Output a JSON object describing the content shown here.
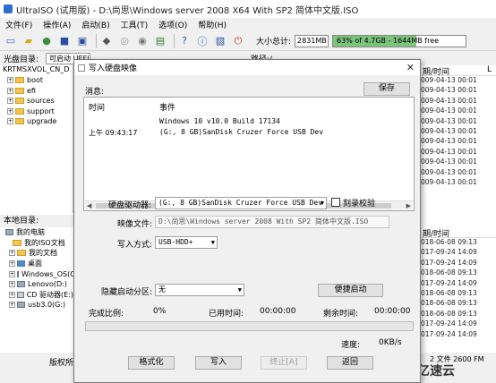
{
  "window": {
    "title": "UltraISO (试用版) - D:\\尚思\\Windows server 2008 X64 With SP2 简体中文版.ISO"
  },
  "menu": [
    "文件(F)",
    "操作(A)",
    "启动(B)",
    "工具(T)",
    "选项(O)",
    "帮助(H)"
  ],
  "toolbar": {
    "size_label": "大小总计:",
    "size_value": "2831MB",
    "capacity_text": "63% of 4.7GB - 1644MB free",
    "capacity_fraction": 0.63
  },
  "disc_bar": {
    "label": "光盘目录:",
    "type_value": "可启动 UEFI",
    "path_label": "路径:/"
  },
  "tree": {
    "root": "KRTMSXVOL_CN_D",
    "folders": [
      "boot",
      "efi",
      "sources",
      "support",
      "upgrade"
    ]
  },
  "right_list": {
    "header": "期/时间",
    "header2": "L",
    "rows": [
      "009-04-13 00:01",
      "009-04-13 00:01",
      "009-04-13 00:01",
      "009-04-13 00:01",
      "009-04-13 00:01",
      "009-04-13 00:01",
      "009-04-13 00:01",
      "009-04-13 00:01",
      "009-04-13 00:01",
      "009-04-13 00:01",
      "009-04-13 00:01"
    ]
  },
  "local": {
    "label": "本地目录:",
    "items": [
      "我的电脑",
      "我的ISO文档",
      "我的文档",
      "桌面",
      "Windows_OS(C:)",
      "Lenovo(D:)",
      "CD 驱动器(E:)",
      "usb3.0(G:)"
    ]
  },
  "right_list2": {
    "header": "期/时间",
    "header2": "",
    "rows": [
      "018-06-08 09:13",
      "017-09-24 14:09",
      "017-09-24 14:09",
      "018-06-08 09:13",
      "017-09-24 14:09",
      "018-06-08 09:13",
      "018-06-08 09:13",
      "018-06-08 09:13",
      "017-09-24 14:09",
      "017-09-24 14:09"
    ]
  },
  "bottom": {
    "left_text": "版权所",
    "right_text": "2 文件  2600 FM",
    "watermark": "亿速云"
  },
  "dialog": {
    "title": "写入硬盘映像",
    "close": "✕",
    "msg_label": "消息:",
    "save_button": "保存",
    "msg_headers": [
      "时间",
      "事件"
    ],
    "messages": [
      {
        "time": "",
        "event": "Windows 10 v10.0 Build 17134"
      },
      {
        "time": "上午 09:43:17",
        "event": "(G:, 8 GB)SanDisk Cruzer Force USB Dev"
      }
    ],
    "drive_label": "硬盘驱动器:",
    "drive_value": "(G:, 8 GB)SanDisk Cruzer Force USB Dev",
    "verify_label": "刻录校验",
    "image_file_label": "映像文件:",
    "image_file_value": "D:\\尚思\\Windows server 2008 With SP2 简体中文版.ISO",
    "write_method_label": "写入方式:",
    "write_method_value": "USB-HDD+",
    "hide_partition_label": "隐藏启动分区:",
    "hide_partition_value": "无",
    "quick_boot_button": "便捷启动",
    "progress_label": "完成比例:",
    "progress_value": "0%",
    "elapsed_label": "已用时间:",
    "elapsed_value": "00:00:00",
    "remaining_label": "剩余时间:",
    "remaining_value": "00:00:00",
    "progress_fraction": 0,
    "speed_label": "速度:",
    "speed_value": "0KB/s",
    "buttons": {
      "format": "格式化",
      "write": "写入",
      "abort": "终止[A]",
      "back": "返回"
    }
  }
}
